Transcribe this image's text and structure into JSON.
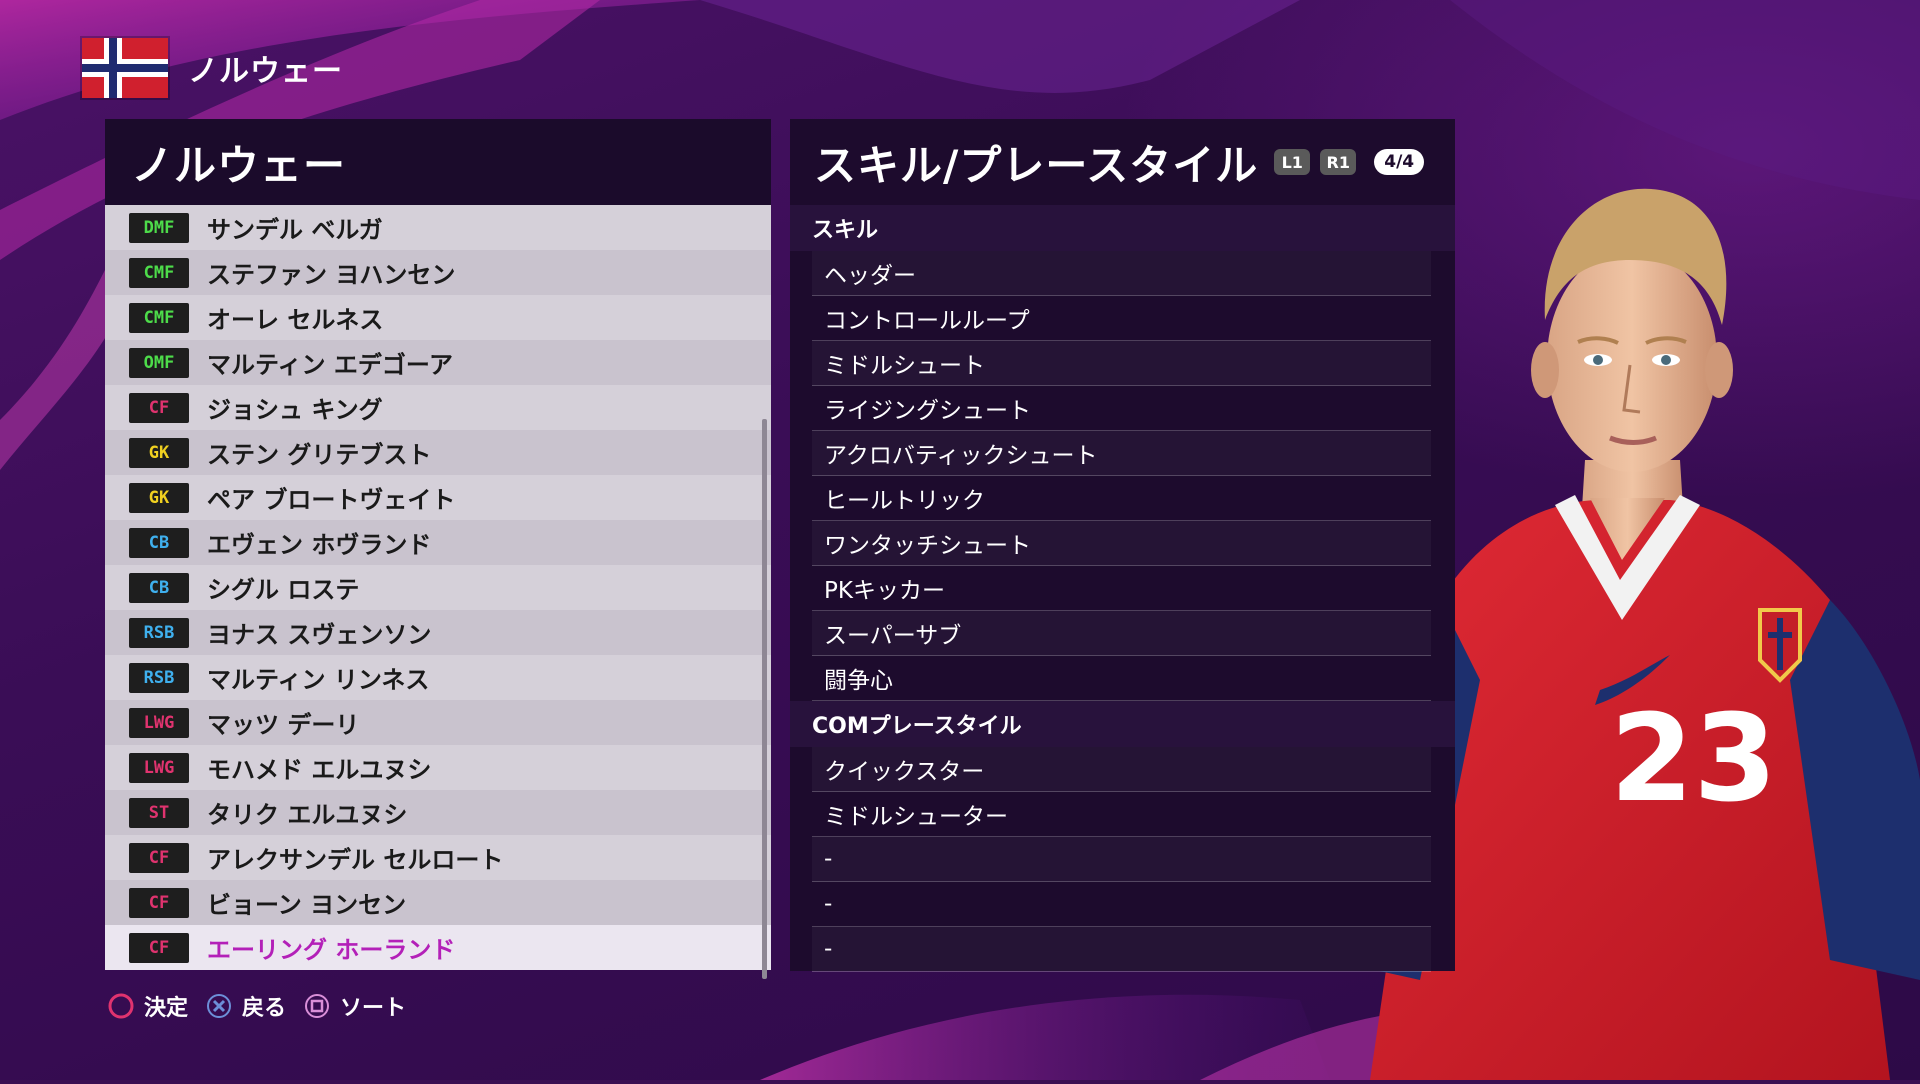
{
  "header": {
    "country": "ノルウェー",
    "flag_icon": "norway-flag-icon"
  },
  "team_panel": {
    "title": "ノルウェー"
  },
  "players": [
    {
      "pos": "DMF",
      "pos_color": "#4ddc4a",
      "name": "サンデル ベルガ"
    },
    {
      "pos": "CMF",
      "pos_color": "#4ddc4a",
      "name": "ステファン ヨハンセン"
    },
    {
      "pos": "CMF",
      "pos_color": "#4ddc4a",
      "name": "オーレ セルネス"
    },
    {
      "pos": "OMF",
      "pos_color": "#4ddc4a",
      "name": "マルティン エデゴーア"
    },
    {
      "pos": "CF",
      "pos_color": "#e0336f",
      "name": "ジョシュ キング"
    },
    {
      "pos": "GK",
      "pos_color": "#f0d020",
      "name": "ステン グリテブスト"
    },
    {
      "pos": "GK",
      "pos_color": "#f0d020",
      "name": "ペア ブロートヴェイト"
    },
    {
      "pos": "CB",
      "pos_color": "#3fb0ee",
      "name": "エヴェン ホヴランド"
    },
    {
      "pos": "CB",
      "pos_color": "#3fb0ee",
      "name": "シグル ロステ"
    },
    {
      "pos": "RSB",
      "pos_color": "#3fb0ee",
      "name": "ヨナス スヴェンソン"
    },
    {
      "pos": "RSB",
      "pos_color": "#3fb0ee",
      "name": "マルティン リンネス"
    },
    {
      "pos": "LWG",
      "pos_color": "#e0336f",
      "name": "マッツ デーリ"
    },
    {
      "pos": "LWG",
      "pos_color": "#e0336f",
      "name": "モハメド エルユヌシ"
    },
    {
      "pos": "ST",
      "pos_color": "#e0336f",
      "name": "タリク エルユヌシ"
    },
    {
      "pos": "CF",
      "pos_color": "#e0336f",
      "name": "アレクサンデル セルロート"
    },
    {
      "pos": "CF",
      "pos_color": "#e0336f",
      "name": "ビョーン ヨンセン"
    },
    {
      "pos": "CF",
      "pos_color": "#e0336f",
      "name": "エーリング ホーランド",
      "selected": true
    }
  ],
  "details": {
    "title": "スキル/プレースタイル",
    "l1_label": "L1",
    "r1_label": "R1",
    "page_indicator": "4/4",
    "skills_heading": "スキル",
    "skills": [
      "ヘッダー",
      "コントロールループ",
      "ミドルシュート",
      "ライジングシュート",
      "アクロバティックシュート",
      "ヒールトリック",
      "ワンタッチシュート",
      "PKキッカー",
      "スーパーサブ",
      "闘争心"
    ],
    "com_heading": "COMプレースタイル",
    "com_styles": [
      "クイックスター",
      "ミドルシューター",
      "-",
      "-",
      "-"
    ]
  },
  "footer": {
    "confirm_label": "決定",
    "back_label": "戻る",
    "sort_label": "ソート",
    "confirm_icon": "circle-button-icon",
    "back_icon": "cross-button-icon",
    "sort_icon": "square-button-icon"
  },
  "player_figure": {
    "shirt_number": "23",
    "shirt_color": "#d8202c",
    "sleeve_color": "#1d2f6e"
  }
}
